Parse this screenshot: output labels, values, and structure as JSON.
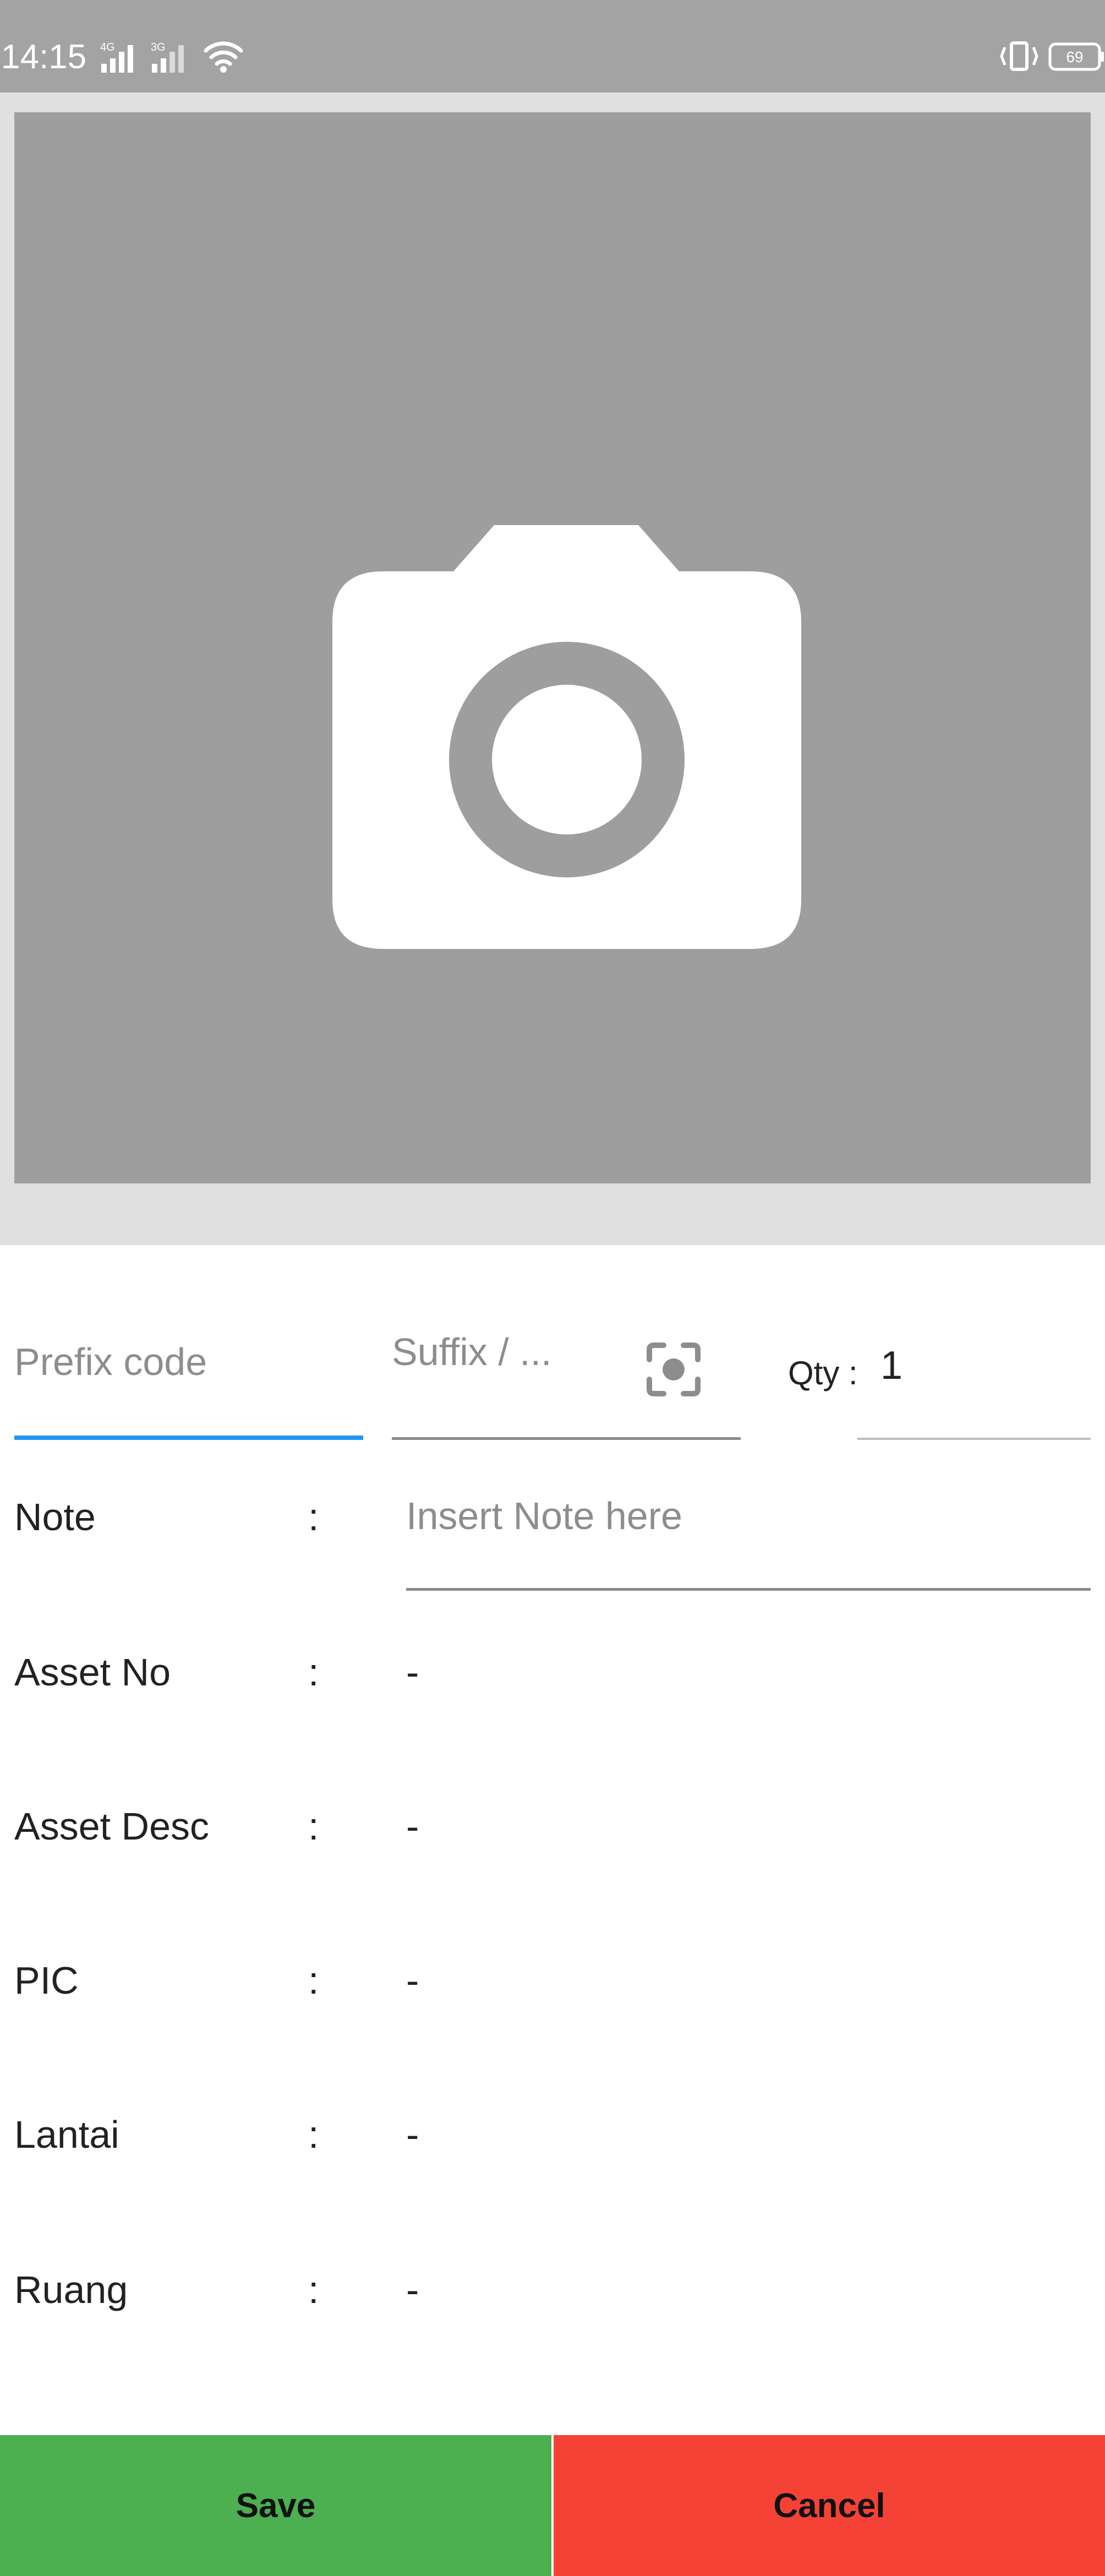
{
  "status_bar": {
    "time": "14:15",
    "network_1": "4G",
    "network_2": "3G",
    "battery": "69"
  },
  "photo": {
    "icon": "camera-icon"
  },
  "form": {
    "prefix_placeholder": "Prefix code",
    "suffix_placeholder": "Suffix / ...",
    "qty_label": "Qty :",
    "qty_value": "1",
    "note_label": "Note",
    "note_placeholder": "Insert Note here",
    "colon": ":",
    "fields": [
      {
        "label": "Asset No",
        "value": "-"
      },
      {
        "label": "Asset Desc",
        "value": "-"
      },
      {
        "label": "PIC",
        "value": "-"
      },
      {
        "label": "Lantai",
        "value": "-"
      },
      {
        "label": "Ruang",
        "value": "-"
      }
    ]
  },
  "buttons": {
    "save": "Save",
    "cancel": "Cancel"
  },
  "colors": {
    "accent": "#2196f3",
    "save": "#4caf50",
    "cancel": "#f44336"
  }
}
